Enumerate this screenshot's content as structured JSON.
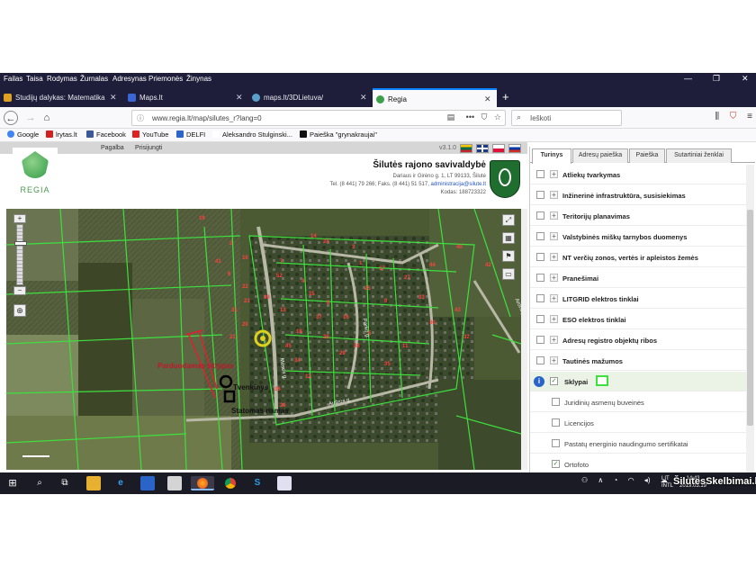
{
  "menubar": [
    "Failas",
    "Taisa",
    "Rodymas",
    "Žurnalas",
    "Adresynas",
    "Priemonės",
    "Žinynas"
  ],
  "window_controls": {
    "minimize": "—",
    "restore": "❐",
    "close": "✕"
  },
  "tabs": [
    {
      "label": "Studijų dalykas: Matematika (S",
      "icon_color": "#e0a020",
      "active": false
    },
    {
      "label": "Maps.lt",
      "icon_color": "#3a66d6",
      "active": false
    },
    {
      "label": "maps.lt/3DLietuva/",
      "icon_color": "#5aa0c8",
      "active": false
    },
    {
      "label": "Regia",
      "icon_color": "#3aa04a",
      "active": true
    }
  ],
  "navbar": {
    "url": "www.regia.lt/map/silutes_r?lang=0",
    "search_placeholder": "Ieškoti",
    "back": "←",
    "forward": "→",
    "home": "⌂",
    "reader": "▤",
    "more": "•••",
    "pocket": "⛉",
    "star": "☆",
    "library": "⫼",
    "shield": "⛉",
    "menu": "≡"
  },
  "bookmarks": [
    {
      "label": "Google",
      "icon_color": "#4285f4"
    },
    {
      "label": "lrytas.lt",
      "icon_color": "#d42020"
    },
    {
      "label": "Facebook",
      "icon_color": "#3b5998"
    },
    {
      "label": "YouTube",
      "icon_color": "#e02020"
    },
    {
      "label": "DELFI",
      "icon_color": "#2a64c8"
    },
    {
      "label": "Aleksandro Stulginski...",
      "icon_color": "#ffffff"
    },
    {
      "label": "Paieška \"grynakraujai\"",
      "icon_color": "#111111"
    }
  ],
  "site": {
    "nav": [
      "Pagalba",
      "Prisijungti"
    ],
    "version": "v3.1.0",
    "logo_text": "REGIA",
    "muni_name": "Šilutės rajono savivaldybė",
    "address": "Dariaus ir Girėno g. 1, LT 99133, Šilutė",
    "tel": "Tel. (8 441) 79 266; Faks. (8 441) 51 517,",
    "email": "administracija@silute.lt",
    "code": "Kodas: 188723322"
  },
  "map": {
    "labels_red": [
      "Parduodamas sklypas"
    ],
    "labels_black": [
      "Tvenkinys",
      "Statomas namas"
    ],
    "roads": [
      "Aroncijų g.",
      "Parko g.",
      "Mėsos g.",
      "Aušros g.",
      "Mėsvaitų g."
    ],
    "parcel_numbers": [
      "19",
      "14",
      "2",
      "10",
      "7",
      "24",
      "3",
      "1",
      "6",
      "22",
      "52",
      "4",
      "15",
      "8",
      "16",
      "25",
      "17",
      "9",
      "27",
      "33",
      "30",
      "11",
      "35",
      "5",
      "18",
      "13",
      "45",
      "34",
      "12",
      "36",
      "26",
      "31",
      "20",
      "21",
      "23",
      "39",
      "28",
      "29",
      "37",
      "38",
      "44",
      "40",
      "42",
      "32",
      "43",
      "41"
    ],
    "tools": [
      "⤢",
      "▦",
      "⚑",
      "▭"
    ],
    "zoom_in": "+",
    "zoom_out": "−",
    "locate": "⊕"
  },
  "panel": {
    "tabs": [
      "Turinys",
      "Adresų paieška",
      "Paieška",
      "Sutartiniai ženklai"
    ],
    "layers": [
      {
        "label": "Atliekų tvarkymas",
        "type": "main",
        "checked": false
      },
      {
        "label": "Inžinerinė infrastruktūra, susisiekimas",
        "type": "main",
        "checked": false
      },
      {
        "label": "Teritorijų planavimas",
        "type": "main",
        "checked": false
      },
      {
        "label": "Valstybinės miškų tarnybos duomenys",
        "type": "main",
        "checked": false
      },
      {
        "label": "NT verčių zonos, vertės ir apleistos žemės",
        "type": "main",
        "checked": false
      },
      {
        "label": "Pranešimai",
        "type": "main",
        "checked": false
      },
      {
        "label": "LITGRID elektros tinklai",
        "type": "main",
        "checked": false
      },
      {
        "label": "ESO elektros tinklai",
        "type": "main",
        "checked": false
      },
      {
        "label": "Adresų registro objektų ribos",
        "type": "main",
        "checked": false
      },
      {
        "label": "Tautinės mažumos",
        "type": "main",
        "checked": false
      },
      {
        "label": "Sklypai",
        "type": "highlight",
        "checked": true
      },
      {
        "label": "Juridinių asmenų buveinės",
        "type": "sub",
        "checked": false
      },
      {
        "label": "Licencijos",
        "type": "sub",
        "checked": false
      },
      {
        "label": "Pastatų energinio naudingumo sertifikatai",
        "type": "sub",
        "checked": false
      },
      {
        "label": "Ortofoto",
        "type": "sub",
        "checked": true
      }
    ],
    "swatch_color": "#3ee03e"
  },
  "taskbar": {
    "lang": "LIT",
    "lang2": "INTL",
    "time": "14:43",
    "date": "2019.03.19"
  },
  "watermark": "ŠilutesSkelbimai.lt"
}
